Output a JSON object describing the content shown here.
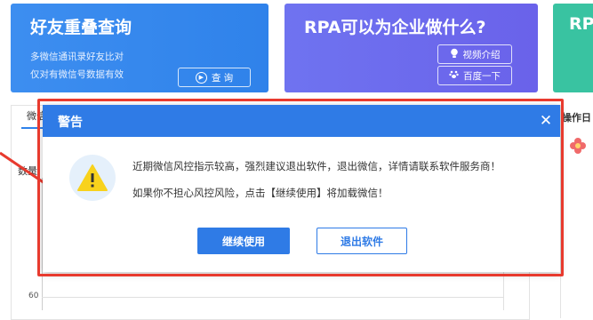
{
  "banners": {
    "friend": {
      "title": "好友重叠查询",
      "line1": "多微信通讯录好友比对",
      "line2": "仅对有微信号数据有效",
      "query_label": "查 询"
    },
    "rpa": {
      "title": "RPA可以为企业做什么?",
      "video_label": "视频介绍",
      "baidu_label": "百度一下"
    },
    "third": {
      "title": "RP"
    }
  },
  "background": {
    "left_tab": "微信",
    "y_label": "数量",
    "y_tick": "60",
    "right_label": "操作日"
  },
  "modal": {
    "title": "警告",
    "close_glyph": "✕",
    "message1": "近期微信风控指示较高，强烈建议退出软件，退出微信，详情请联系软件服务商！",
    "message2": "如果你不担心风控风险，点击【继续使用】将加载微信！",
    "continue_label": "继续使用",
    "exit_label": "退出软件"
  },
  "colors": {
    "primary": "#2f7be6",
    "highlight_red": "#e83a2e",
    "banner_blue": "#2f82ea",
    "banner_purple": "#6a62ea",
    "banner_green": "#39c3a1",
    "warning_yellow": "#f8d21c"
  }
}
